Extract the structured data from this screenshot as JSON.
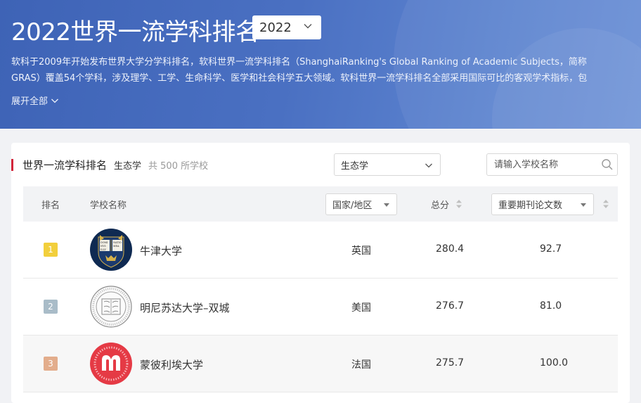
{
  "hero": {
    "title": "2022世界一流学科排名",
    "year_selected": "2022",
    "description_line1": "软科于2009年开始发布世界大学分学科排名，软科世界一流学科排名（ShanghaiRanking's Global Ranking of Academic Subjects，简称",
    "description_line2": "GRAS）覆盖54个学科，涉及理学、工学、生命科学、医学和社会科学五大领域。软科世界一流学科排名全部采用国际可比的客观学术指标，包",
    "expand_label": "展开全部"
  },
  "card": {
    "title": "世界一流学科排名",
    "subject": "生态学",
    "count_text": "共 500 所学校",
    "subject_select_value": "生态学",
    "search_placeholder": "请输入学校名称"
  },
  "table": {
    "headers": {
      "rank": "排名",
      "name": "学校名称",
      "region": "国家/地区",
      "score": "总分",
      "indicator": "重要期刊论文数"
    },
    "rows": [
      {
        "rank": "1",
        "name": "牛津大学",
        "country": "英国",
        "score": "280.4",
        "papers": "92.7",
        "rank_color": "#f2cf3c",
        "logo": "oxford-crest-icon"
      },
      {
        "rank": "2",
        "name": "明尼苏达大学–双城",
        "country": "美国",
        "score": "276.7",
        "papers": "81.0",
        "rank_color": "#a9bcc8",
        "logo": "minnesota-seal-icon"
      },
      {
        "rank": "3",
        "name": "蒙彼利埃大学",
        "country": "法国",
        "score": "275.7",
        "papers": "100.0",
        "rank_color": "#e3ad8c",
        "logo": "montpellier-logo-icon"
      }
    ]
  }
}
